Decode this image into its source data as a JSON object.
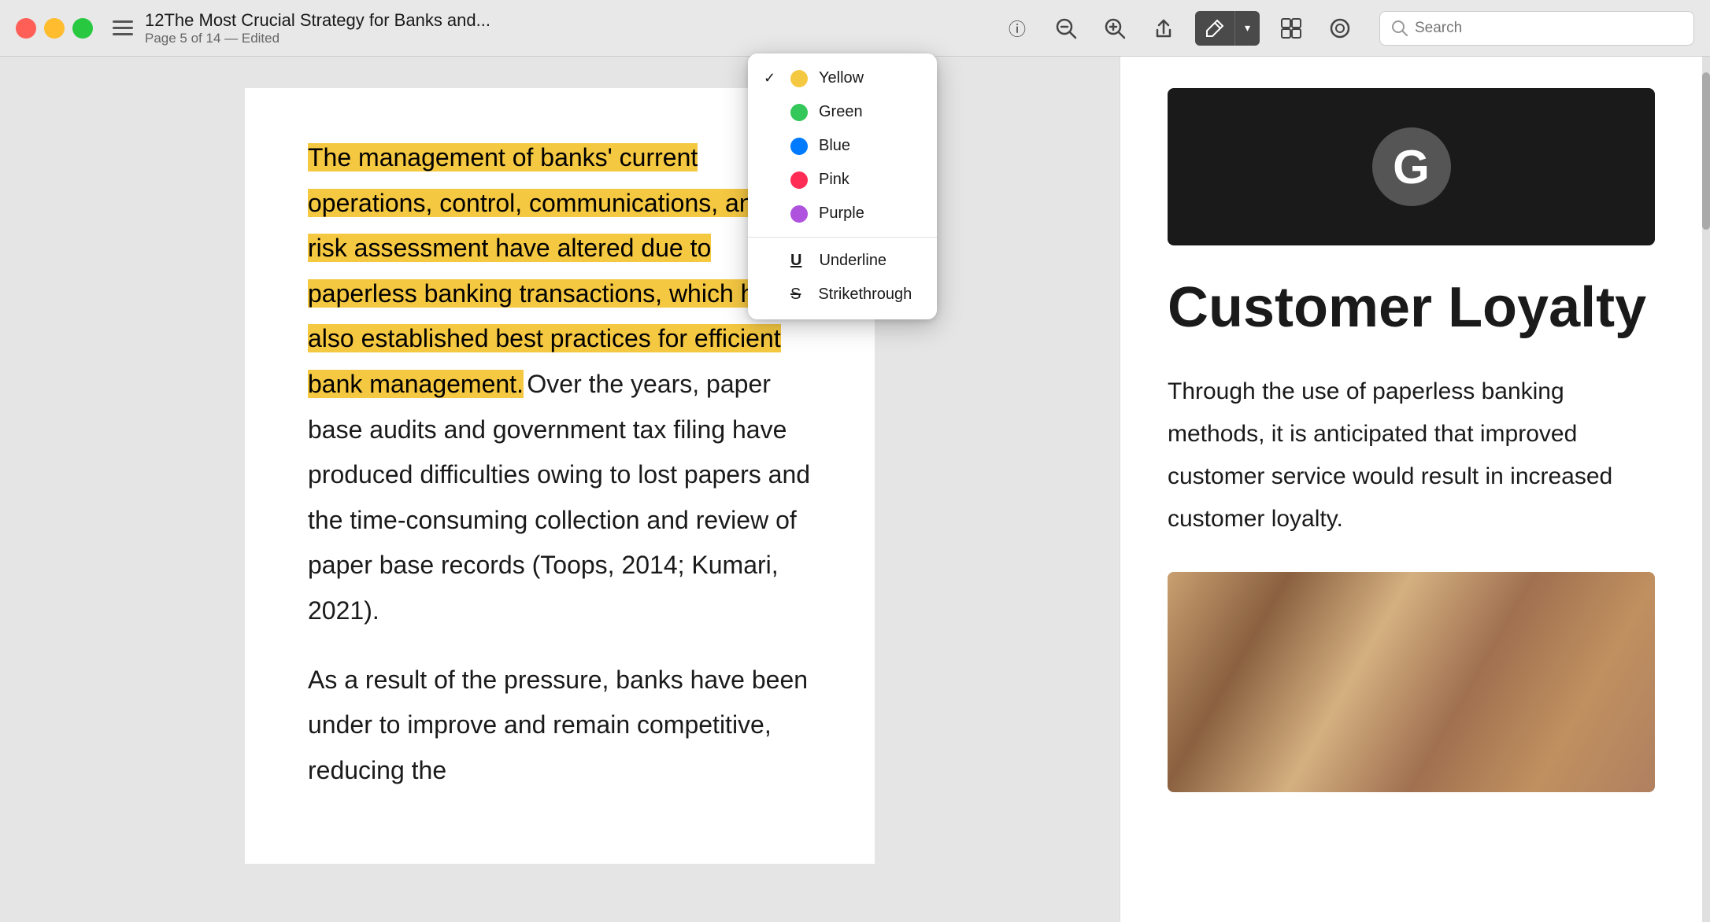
{
  "titlebar": {
    "doc_title": "12The Most Crucial Strategy for Banks and...",
    "doc_subtitle": "Page 5 of 14 — Edited",
    "search_placeholder": "Search"
  },
  "toolbar": {
    "icons": [
      "ℹ",
      "🔍−",
      "🔍+",
      "⬆",
      "✏",
      "▾",
      "⧉",
      "◎"
    ],
    "highlight_label": "✏",
    "arrow_label": "▾"
  },
  "document": {
    "highlighted_paragraph": "The management of banks' current operations, control, communications, and risk assessment have altered due to paperless banking transactions, which have also established best practices for efficient bank management.",
    "body_paragraph1": "Over the years, paper base audits and government tax filing have produced difficulties owing to lost papers and the time-consuming collection and review of paper base records (Toops, 2014; Kumari, 2021).",
    "body_paragraph2": "As a result of the pressure, banks have been under to improve and remain competitive, reducing the"
  },
  "right_panel": {
    "section_title": "Customer Loyalty",
    "section_body": "Through the use of paperless banking methods, it is anticipated that improved customer service would result in increased customer loyalty."
  },
  "dropdown": {
    "items": [
      {
        "label": "Yellow",
        "color": "yellow",
        "checked": true
      },
      {
        "label": "Green",
        "color": "green",
        "checked": false
      },
      {
        "label": "Blue",
        "color": "blue",
        "checked": false
      },
      {
        "label": "Pink",
        "color": "pink",
        "checked": false
      },
      {
        "label": "Purple",
        "color": "purple",
        "checked": false
      }
    ],
    "underline_label": "Underline",
    "strikethrough_label": "Strikethrough"
  }
}
